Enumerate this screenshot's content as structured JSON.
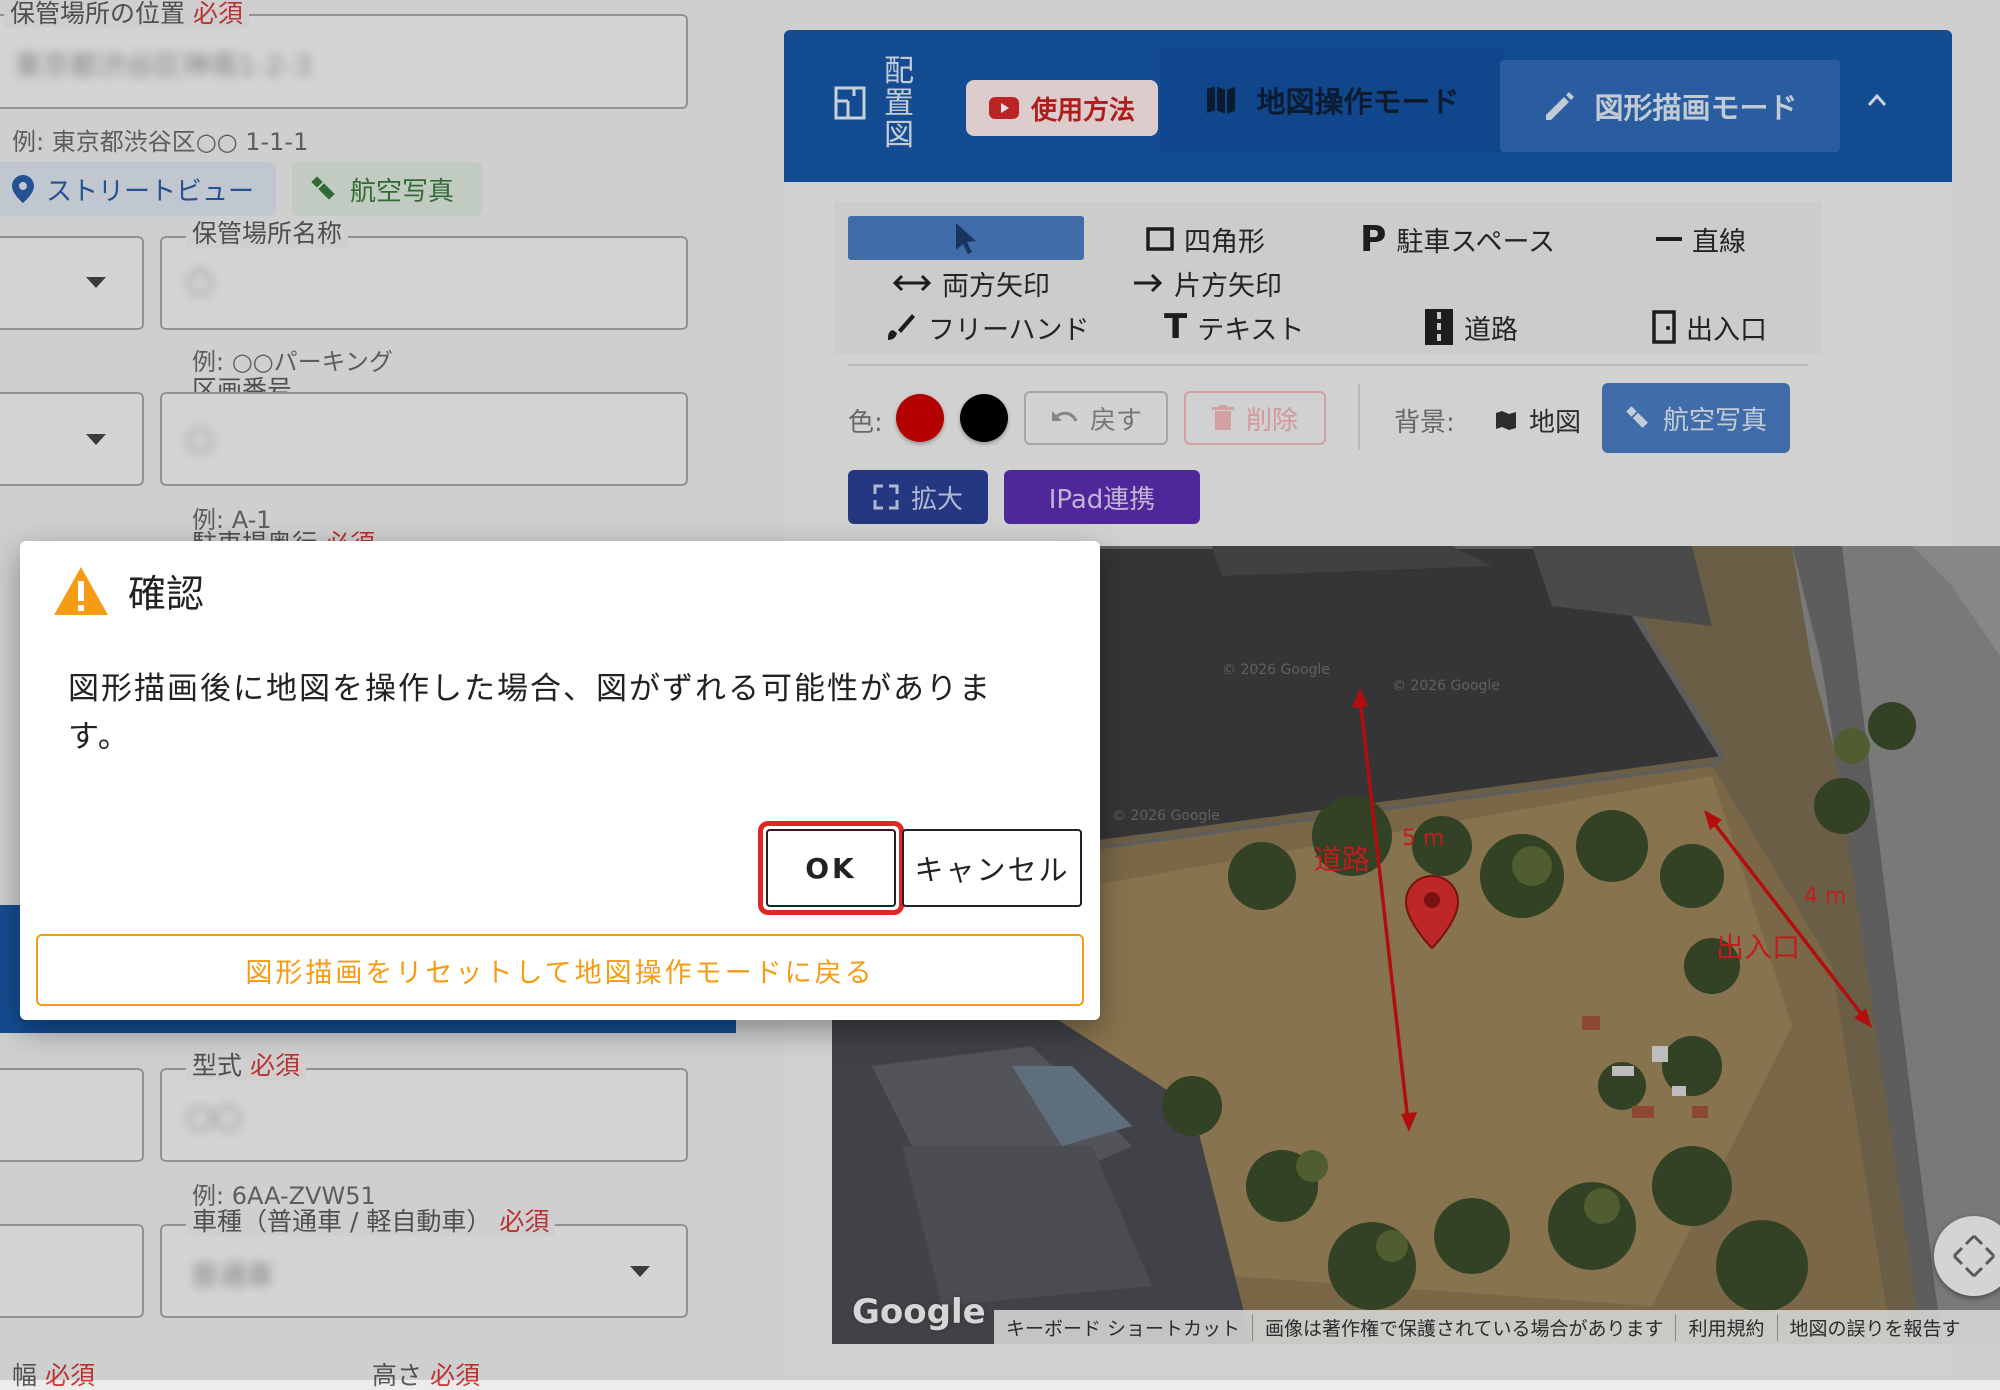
{
  "form": {
    "location_label": "保管場所の位置",
    "required": "必須",
    "location_value": "東京都渋谷区神南1-2-3",
    "location_hint": "例: 東京都渋谷区○○ 1-1-1",
    "street_view": "ストリートビュー",
    "aerial_photo": "航空写真",
    "storage_name_label": "保管場所名称",
    "storage_name_value": "〇",
    "storage_name_hint": "例: ○○パーキング",
    "lot_number_label": "区画番号",
    "lot_number_value": "〇",
    "lot_number_hint": "例: A-1",
    "depth_label": "駐車場奥行",
    "model_label": "型式",
    "model_value": "〇〇",
    "model_hint": "例: 6AA-ZVW51",
    "vehicle_type_label": "車種（普通車 / 軽自動車）",
    "vehicle_type_value": "普通車",
    "width_label": "幅",
    "height_label": "高さ"
  },
  "panel": {
    "title": "配置図",
    "howto": "使用方法",
    "map_mode": "地図操作モード",
    "draw_mode": "図形描画モード",
    "tools": {
      "rect": "四角形",
      "parking": "駐車スペース",
      "line": "直線",
      "double_arrow": "両方矢印",
      "single_arrow": "片方矢印",
      "freehand": "フリーハンド",
      "text": "テキスト",
      "road": "道路",
      "entrance": "出入口"
    },
    "color_label": "色:",
    "colors": [
      "#cc0000",
      "#000000"
    ],
    "undo": "戻す",
    "delete": "削除",
    "bg_label": "背景:",
    "bg_map": "地図",
    "bg_aerial": "航空写真",
    "expand": "拡大",
    "ipad": "IPad連携"
  },
  "map": {
    "road_label": "道路",
    "road_dim": "5 m",
    "entrance_label": "出入口",
    "entrance_dim": "4 m",
    "watermark": "© 2026 Google",
    "google": "Google",
    "footer": {
      "shortcuts": "キーボード ショートカット",
      "copyright": "画像は著作権で保護されている場合があります",
      "terms": "利用規約",
      "report": "地図の誤りを報告す"
    }
  },
  "dialog": {
    "title": "確認",
    "message": "図形描画後に地図を操作した場合、図がずれる可能性があります。",
    "ok": "OK",
    "cancel": "キャンセル",
    "reset": "図形描画をリセットして地図操作モードに戻る"
  }
}
